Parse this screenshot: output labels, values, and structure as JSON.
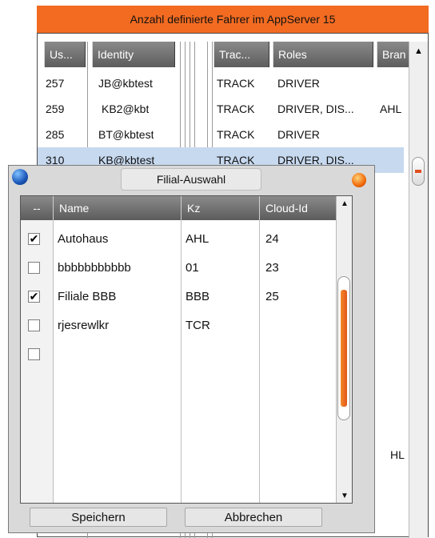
{
  "banner": "Anzahl definierte Fahrer im AppServer 15",
  "drivers_table": {
    "columns": [
      "Us...",
      "Identity",
      "Trac...",
      "Roles",
      "Bran"
    ],
    "rows": [
      {
        "user": "257",
        "identity": "JB@kbtest",
        "track": "TRACK",
        "roles": "DRIVER",
        "branch": ""
      },
      {
        "user": "259",
        "identity": "KB2@kbt",
        "track": "TRACK",
        "roles": "DRIVER, DIS...",
        "branch": "AHL"
      },
      {
        "user": "285",
        "identity": "BT@kbtest",
        "track": "TRACK",
        "roles": "DRIVER",
        "branch": ""
      },
      {
        "user": "310",
        "identity": "KB@kbtest",
        "track": "TRACK",
        "roles": "DRIVER, DIS...",
        "branch": ""
      }
    ],
    "partial_branch": "HL"
  },
  "dialog": {
    "title": "Filial-Auswahl",
    "columns": [
      "--",
      "Name",
      "Kz",
      "Cloud-Id"
    ],
    "rows": [
      {
        "checked": true,
        "name": "Autohaus",
        "kz": "AHL",
        "cloud_id": "24"
      },
      {
        "checked": false,
        "name": "bbbbbbbbbbb",
        "kz": "01",
        "cloud_id": "23"
      },
      {
        "checked": true,
        "name": "Filiale BBB",
        "kz": "BBB",
        "cloud_id": "25"
      },
      {
        "checked": false,
        "name": "rjesrewlkr",
        "kz": "TCR",
        "cloud_id": ""
      },
      {
        "checked": false,
        "name": "",
        "kz": "",
        "cloud_id": ""
      }
    ],
    "save_label": "Speichern",
    "cancel_label": "Abbrechen"
  },
  "colors": {
    "banner": "#f26b21",
    "header": "#6f6f6f",
    "selection": "#c7d9ef",
    "scroll_thumb": "#f07a25"
  }
}
